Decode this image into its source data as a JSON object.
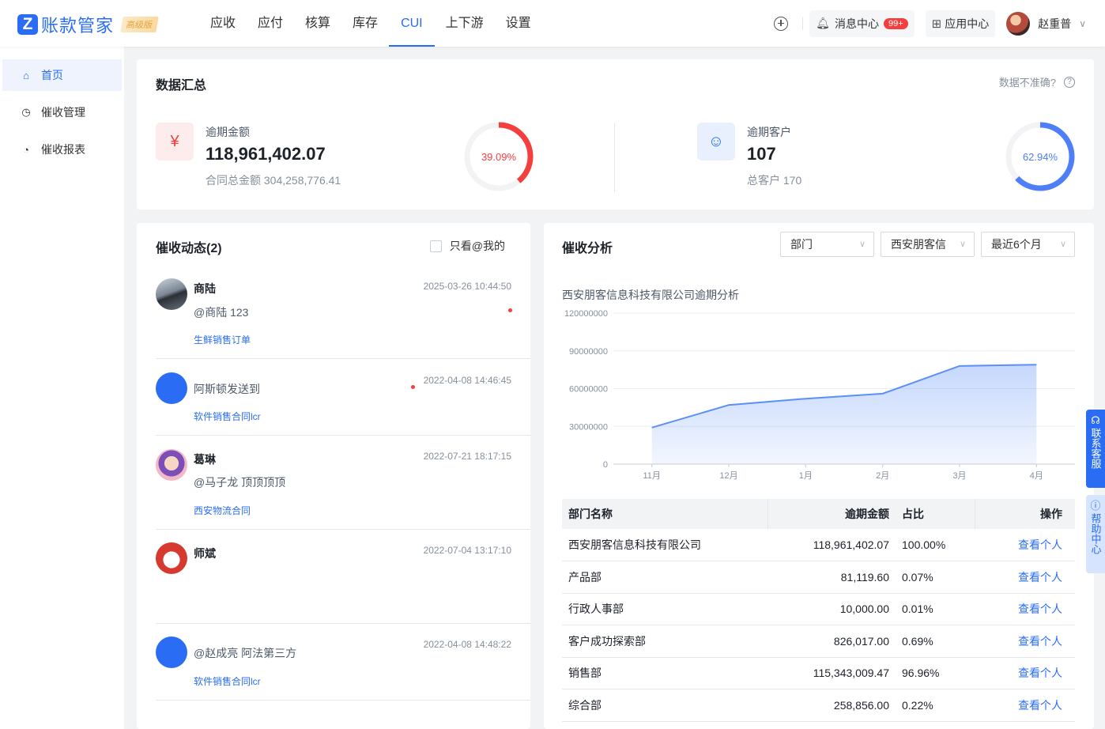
{
  "app": {
    "logo_letter": "Z",
    "name": "账款管家",
    "edition": "高级版"
  },
  "nav": [
    {
      "label": "应收"
    },
    {
      "label": "应付"
    },
    {
      "label": "核算"
    },
    {
      "label": "库存"
    },
    {
      "label": "CUI",
      "active": true
    },
    {
      "label": "上下游"
    },
    {
      "label": "设置"
    }
  ],
  "header": {
    "message_center": "消息中心",
    "message_badge": "99+",
    "app_center": "应用中心",
    "user_name": "赵重普"
  },
  "sidebar": {
    "items": [
      {
        "label": "首页",
        "icon": "home-icon",
        "active": true
      },
      {
        "label": "催收管理",
        "icon": "clock-icon"
      },
      {
        "label": "催收报表",
        "icon": "report-icon"
      }
    ]
  },
  "summary": {
    "title": "数据汇总",
    "hint": "数据不准确?",
    "overdue_amount": {
      "label": "逾期金额",
      "value": "118,961,402.07",
      "sub": "合同总金额 304,258,776.41",
      "percent_text": "39.09%",
      "percent": 0.3909,
      "color": "#f53f3f"
    },
    "overdue_customers": {
      "label": "逾期客户",
      "value": "107",
      "sub": "总客户 170",
      "percent_text": "62.94%",
      "percent": 0.6294,
      "color": "#4e7ff6"
    }
  },
  "feed": {
    "title": "催收动态(2)",
    "only_mine": "只看@我的",
    "items": [
      {
        "name": "商陆",
        "text": "@商陆 123",
        "link": "生鲜销售订单",
        "time": "2025-03-26 10:44:50"
      },
      {
        "name": "",
        "text": "阿斯顿发送到",
        "link": "软件销售合同lcr",
        "time": "2022-04-08 14:46:45"
      },
      {
        "name": "葛琳",
        "text": "@马子龙 顶顶顶顶",
        "link": "西安物流合同",
        "time": "2022-07-21 18:17:15"
      },
      {
        "name": "师斌",
        "text": "",
        "link": "",
        "time": "2022-07-04 13:17:10"
      },
      {
        "name": "",
        "text": "@赵成亮 阿法第三方",
        "link": "软件销售合同lcr",
        "time": "2022-04-08 14:48:22"
      }
    ]
  },
  "analysis": {
    "title": "催收分析",
    "filters": [
      "部门",
      "西安朋客信",
      "最近6个月"
    ],
    "chart_heading": "西安朋客信息科技有限公司逾期分析",
    "table_headers": [
      "部门名称",
      "逾期金额",
      "占比",
      "操作"
    ],
    "rows": [
      {
        "dept": "西安朋客信息科技有限公司",
        "amount": "118,961,402.07",
        "ratio": "100.00%",
        "action": "查看个人"
      },
      {
        "dept": "产品部",
        "amount": "81,119.60",
        "ratio": "0.07%",
        "action": "查看个人"
      },
      {
        "dept": "行政人事部",
        "amount": "10,000.00",
        "ratio": "0.01%",
        "action": "查看个人"
      },
      {
        "dept": "客户成功探索部",
        "amount": "826,017.00",
        "ratio": "0.69%",
        "action": "查看个人"
      },
      {
        "dept": "销售部",
        "amount": "115,343,009.47",
        "ratio": "96.96%",
        "action": "查看个人"
      },
      {
        "dept": "综合部",
        "amount": "258,856.00",
        "ratio": "0.22%",
        "action": "查看个人"
      }
    ]
  },
  "chart_data": {
    "type": "area",
    "title": "西安朋客信息科技有限公司逾期分析",
    "categories": [
      "11月",
      "12月",
      "1月",
      "2月",
      "3月",
      "4月"
    ],
    "values": [
      29000000,
      47000000,
      52000000,
      56000000,
      78000000,
      79000000
    ],
    "ylim": [
      0,
      120000000
    ],
    "yticks": [
      0,
      30000000,
      60000000,
      90000000,
      120000000
    ],
    "color": "#5b8ff9"
  },
  "float_tabs": {
    "service": "联系客服",
    "help": "帮助中心"
  }
}
